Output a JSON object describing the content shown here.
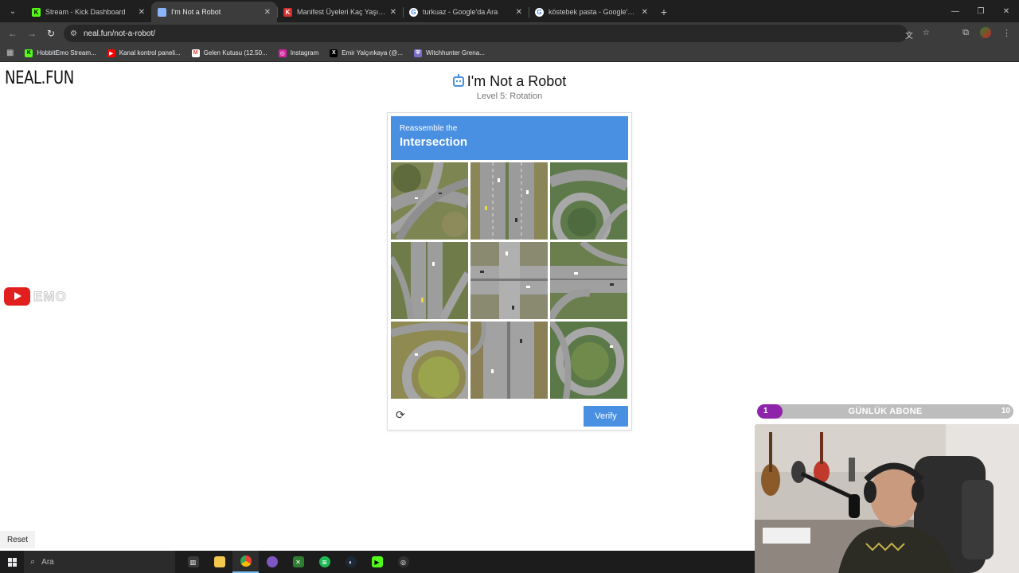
{
  "browser": {
    "tabs": [
      {
        "label": "Stream - Kick Dashboard",
        "favicon": "kick-icon",
        "active": false
      },
      {
        "label": "I'm Not a Robot",
        "favicon": "robot-icon",
        "active": true
      },
      {
        "label": "Manifest Üyeleri Kaç Yaşında? |",
        "favicon": "news-icon",
        "active": false
      },
      {
        "label": "turkuaz - Google'da Ara",
        "favicon": "google-icon",
        "active": false
      },
      {
        "label": "köstebek pasta - Google'da Ara",
        "favicon": "google-icon",
        "active": false
      }
    ],
    "url": "neal.fun/not-a-robot/",
    "bookmarks": [
      {
        "label": "HobbitEmo Stream...",
        "icon": "kick-icon",
        "color": "#53fc18"
      },
      {
        "label": "Kanal kontrol paneli...",
        "icon": "youtube-icon",
        "color": "#ff0000"
      },
      {
        "label": "Gelen Kutusu (12.50...",
        "icon": "gmail-icon",
        "color": "#ea4335"
      },
      {
        "label": "Instagram",
        "icon": "instagram-icon",
        "color": "#d6249f"
      },
      {
        "label": "Emir Yalçınkaya (@...",
        "icon": "x-icon",
        "color": "#000000"
      },
      {
        "label": "Witchhunter Grena...",
        "icon": "shield-icon",
        "color": "#7b6cc4"
      }
    ]
  },
  "page": {
    "logo": "NEAL.FUN",
    "title": "I'm Not a Robot",
    "subtitle": "Level 5: Rotation",
    "reset_label": "Reset"
  },
  "captcha": {
    "instruction": "Reassemble the",
    "target": "Intersection",
    "verify_label": "Verify",
    "accent": "#4a90e2",
    "tiles": [
      {
        "pos": "top-left"
      },
      {
        "pos": "top-center"
      },
      {
        "pos": "top-right"
      },
      {
        "pos": "middle-left"
      },
      {
        "pos": "center"
      },
      {
        "pos": "middle-right"
      },
      {
        "pos": "bottom-left"
      },
      {
        "pos": "bottom-center"
      },
      {
        "pos": "bottom-right"
      }
    ]
  },
  "overlay": {
    "youtube_text": "EMO",
    "sub_goal": {
      "label": "GÜNLÜK ABONE",
      "current": "1",
      "goal": "10",
      "progress": 0.1,
      "color": "#8e24aa"
    }
  },
  "taskbar": {
    "search_placeholder": "Ara",
    "apps": [
      {
        "name": "task-view-icon",
        "glyph": "▥",
        "color": "#3a3a3a"
      },
      {
        "name": "file-explorer-icon",
        "glyph": "▬",
        "color": "#f2c94c"
      },
      {
        "name": "chrome-icon",
        "glyph": "●",
        "color": "#ea4335",
        "active": true
      },
      {
        "name": "chat-app-icon",
        "glyph": "◉",
        "color": "#7e57c2"
      },
      {
        "name": "terminal-icon",
        "glyph": "✕",
        "color": "#2e7d32"
      },
      {
        "name": "spotify-icon",
        "glyph": "≋",
        "color": "#1db954"
      },
      {
        "name": "steam-icon",
        "glyph": "◐",
        "color": "#1b2838"
      },
      {
        "name": "kick-app-icon",
        "glyph": "▶",
        "color": "#53fc18"
      },
      {
        "name": "obs-icon",
        "glyph": "◎",
        "color": "#303030"
      }
    ]
  }
}
